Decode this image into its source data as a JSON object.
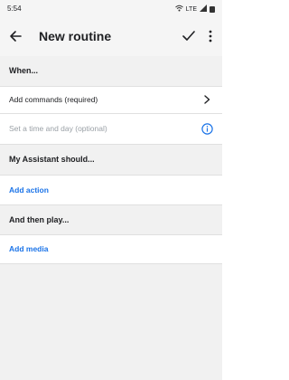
{
  "status_bar": {
    "time": "5:54",
    "network": "LTE"
  },
  "app_bar": {
    "title": "New routine",
    "back_icon": "arrow-left-icon",
    "confirm_icon": "checkmark-icon",
    "menu_icon": "more-vert-icon"
  },
  "when": {
    "header": "When...",
    "add_commands": "Add commands (required)",
    "set_time": "Set a time and day (optional)"
  },
  "assistant": {
    "header": "My Assistant should...",
    "add_action": "Add action"
  },
  "then_play": {
    "header": "And then play...",
    "add_media": "Add media"
  },
  "colors": {
    "accent": "#1a73e8",
    "section_bg": "#f1f1f1"
  }
}
